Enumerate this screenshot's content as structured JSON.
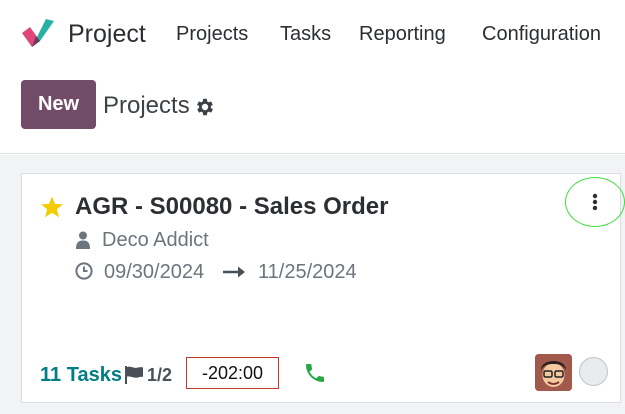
{
  "navbar": {
    "app_title": "Project",
    "menu": [
      {
        "label": "Projects"
      },
      {
        "label": "Tasks"
      },
      {
        "label": "Reporting"
      },
      {
        "label": "Configuration"
      }
    ]
  },
  "control_panel": {
    "new_label": "New",
    "breadcrumb": "Projects"
  },
  "card": {
    "favorite": true,
    "title": "AGR - S00080 - Sales Order",
    "customer": "Deco Addict",
    "date_start": "09/30/2024",
    "date_end": "11/25/2024",
    "tasks_count": "11",
    "tasks_label": "Tasks",
    "milestones": "1/2",
    "hours_remaining": "-202:00"
  },
  "colors": {
    "brand": "#714b67",
    "star": "#f3cc00",
    "tasks_link": "#017e84",
    "phone": "#28a745",
    "hours_border": "#c0392b",
    "highlight_ring": "#3ee03e"
  },
  "icons": [
    "logo-icon",
    "gear-icon",
    "star-icon",
    "kebab-menu-icon",
    "person-icon",
    "clock-icon",
    "arrow-right-icon",
    "flag-icon",
    "phone-icon"
  ]
}
